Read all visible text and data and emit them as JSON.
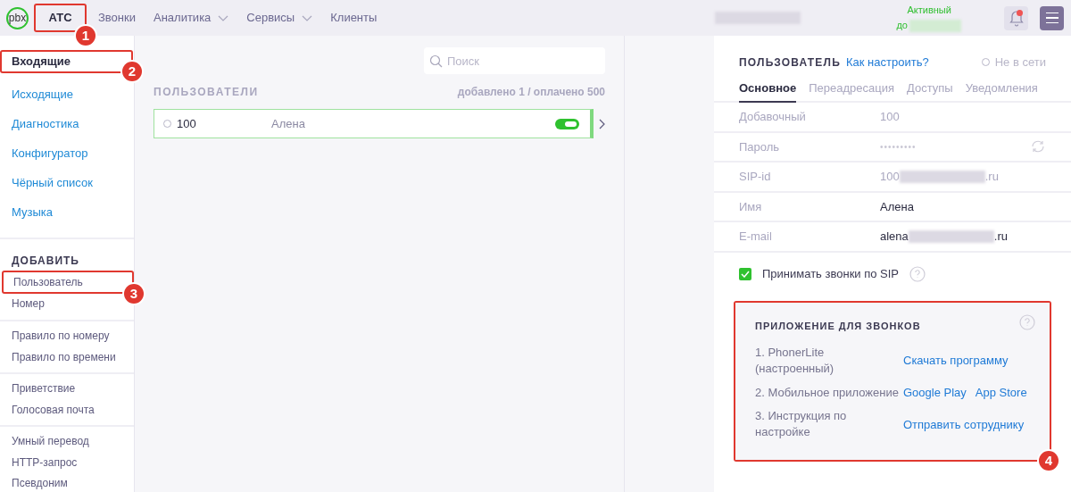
{
  "topbar": {
    "logo": "pbx",
    "nav": [
      {
        "label": "АТС",
        "selected": true,
        "dropdown": false
      },
      {
        "label": "Звонки",
        "selected": false,
        "dropdown": false
      },
      {
        "label": "Аналитика",
        "selected": false,
        "dropdown": true
      },
      {
        "label": "Сервисы",
        "selected": false,
        "dropdown": true
      },
      {
        "label": "Клиенты",
        "selected": false,
        "dropdown": false
      }
    ],
    "status": {
      "line1": "Активный",
      "line2": "до"
    },
    "notifications": {
      "unread": true
    }
  },
  "sidebar": {
    "groups": [
      {
        "items": [
          {
            "label": "Входящие",
            "selected": true
          },
          {
            "label": "Исходящие",
            "selected": false
          },
          {
            "label": "Диагностика",
            "selected": false
          },
          {
            "label": "Конфигуратор",
            "selected": false
          },
          {
            "label": "Чёрный список",
            "selected": false
          },
          {
            "label": "Музыка",
            "selected": false
          }
        ]
      },
      {
        "heading": "ДОБАВИТЬ",
        "items": [
          {
            "label": "Пользователь",
            "selected": false
          },
          {
            "label": "Номер",
            "selected": false
          }
        ]
      },
      {
        "items": [
          {
            "label": "Правило по номеру",
            "selected": false
          },
          {
            "label": "Правило по времени",
            "selected": false
          }
        ]
      },
      {
        "items": [
          {
            "label": "Приветствие",
            "selected": false
          },
          {
            "label": "Голосовая почта",
            "selected": false
          }
        ]
      },
      {
        "items": [
          {
            "label": "Умный перевод",
            "selected": false
          },
          {
            "label": "HTTP-запрос",
            "selected": false
          },
          {
            "label": "Псевдоним",
            "selected": false
          }
        ]
      }
    ]
  },
  "users": {
    "search": {
      "placeholder": "Поиск"
    },
    "title": "ПОЛЬЗОВАТЕЛИ",
    "count": "добавлено 1 / оплачено 500",
    "rows": [
      {
        "number": "100",
        "name": "Алена",
        "online": false,
        "enabled": true,
        "selected": true
      }
    ]
  },
  "panel": {
    "title": "ПОЛЬЗОВАТЕЛЬ",
    "help_link": "Как настроить?",
    "status": "Не в сети",
    "online": false,
    "tabs": [
      {
        "label": "Основное",
        "selected": true
      },
      {
        "label": "Переадресация",
        "selected": false
      },
      {
        "label": "Доступы",
        "selected": false
      },
      {
        "label": "Уведомления",
        "selected": false
      }
    ],
    "fields": [
      {
        "label": "Добавочный",
        "value": "100",
        "kind": "muted"
      },
      {
        "label": "Пароль",
        "value": "•••••••••",
        "kind": "password"
      },
      {
        "label": "SIP-id",
        "value": "100",
        "suffix": ".ru",
        "kind": "redacted-muted"
      },
      {
        "label": "Имя",
        "value": "Алена",
        "kind": "plain"
      },
      {
        "label": "E-mail",
        "value": "alena",
        "suffix": ".ru",
        "kind": "redacted"
      }
    ],
    "accept_sip": {
      "label": "Принимать звонки по SIP",
      "checked": true
    },
    "apps": {
      "title": "ПРИЛОЖЕНИЕ ДЛЯ ЗВОНКОВ",
      "rows": [
        {
          "label": "1. PhonerLite (настроенный)",
          "links": [
            "Скачать программу"
          ]
        },
        {
          "label": "2. Мобильное приложение",
          "links": [
            "Google Play",
            "App Store"
          ]
        },
        {
          "label": "3. Инструкция по настройке",
          "links": [
            "Отправить сотруднику"
          ]
        }
      ]
    }
  },
  "annotations": [
    {
      "number": "1"
    },
    {
      "number": "2"
    },
    {
      "number": "3"
    },
    {
      "number": "4"
    }
  ]
}
